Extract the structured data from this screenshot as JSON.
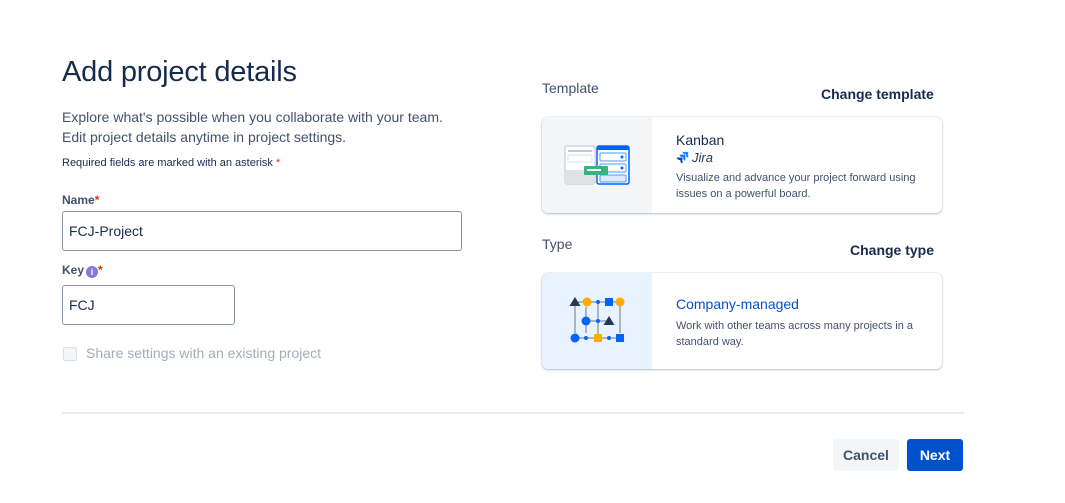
{
  "page": {
    "title": "Add project details",
    "description_line1": "Explore what's possible when you collaborate with your team.",
    "description_line2": "Edit project details anytime in project settings.",
    "required_note": "Required fields are marked with an asterisk",
    "asterisk": "*"
  },
  "form": {
    "name_label": "Name",
    "name_value": "FCJ-Project",
    "key_label": "Key",
    "key_value": "FCJ",
    "key_info_icon": "info-icon",
    "share_label": "Share settings with an existing project",
    "share_checked": false
  },
  "template": {
    "section_label": "Template",
    "change_label": "Change template",
    "name": "Kanban",
    "product": "Jira",
    "description": "Visualize and advance your project forward using issues on a powerful board."
  },
  "type": {
    "section_label": "Type",
    "change_label": "Change type",
    "name": "Company-managed",
    "description": "Work with other teams across many projects in a standard way."
  },
  "footer": {
    "cancel_label": "Cancel",
    "next_label": "Next"
  },
  "colors": {
    "accent": "#0052cc",
    "link": "#0052cc",
    "required": "#de350b",
    "info_badge": "#8777d9"
  }
}
